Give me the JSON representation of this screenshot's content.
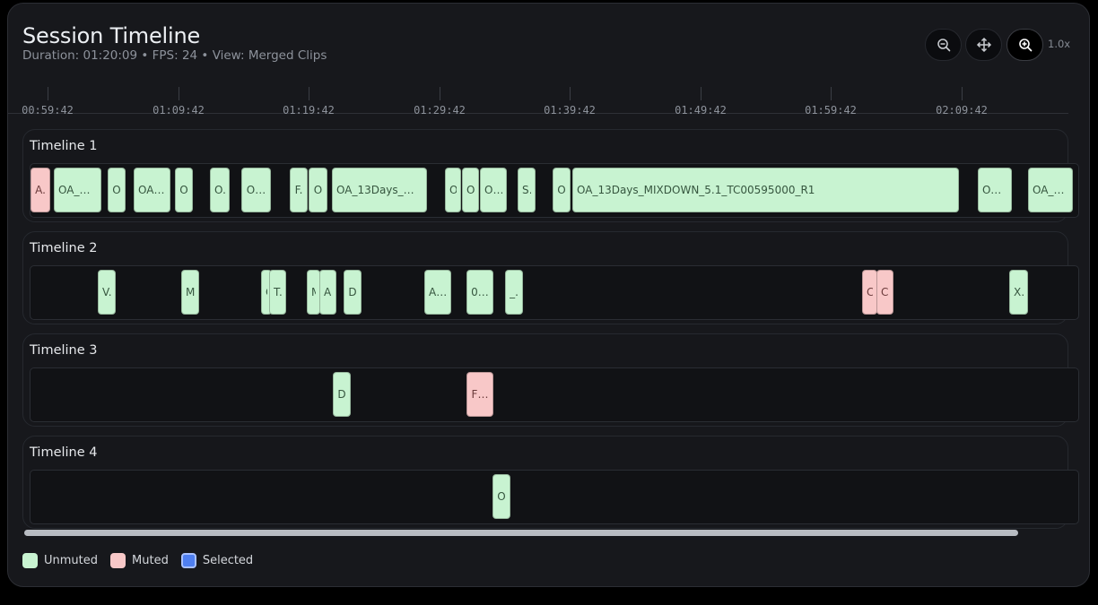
{
  "header": {
    "title": "Session Timeline",
    "subtitle": "Duration: 01:20:09 • FPS: 24 • View: Merged Clips"
  },
  "toolbar": {
    "zoom_out_icon": "zoom-out-icon",
    "pan_icon": "move-icon",
    "zoom_in_icon": "zoom-in-icon",
    "zoom_level": "1.0x"
  },
  "ruler": {
    "ticks": [
      "00:59:42",
      "01:09:42",
      "01:19:42",
      "01:29:42",
      "01:39:42",
      "01:49:42",
      "01:59:42",
      "02:09:42"
    ]
  },
  "tracks": [
    {
      "name": "Timeline 1",
      "clips": [
        {
          "label": "A.",
          "muted": true
        },
        {
          "label": "OA_1…",
          "muted": false
        },
        {
          "label": "O",
          "muted": false
        },
        {
          "label": "OA…",
          "muted": false
        },
        {
          "label": "O",
          "muted": false
        },
        {
          "label": "O.",
          "muted": false
        },
        {
          "label": "O…",
          "muted": false
        },
        {
          "label": "F.",
          "muted": false
        },
        {
          "label": "O",
          "muted": false
        },
        {
          "label": "OA_13Days_MI…",
          "muted": false
        },
        {
          "label": "O",
          "muted": false
        },
        {
          "label": "O",
          "muted": false
        },
        {
          "label": "O…",
          "muted": false
        },
        {
          "label": "S.",
          "muted": false
        },
        {
          "label": "O",
          "muted": false
        },
        {
          "label": "OA_13Days_MIXDOWN_5.1_TC00595000_R1",
          "muted": false
        },
        {
          "label": "OA…",
          "muted": false
        },
        {
          "label": "OA_1…",
          "muted": false
        }
      ]
    },
    {
      "name": "Timeline 2",
      "clips": [
        {
          "label": "V.",
          "muted": false
        },
        {
          "label": "M",
          "muted": false
        },
        {
          "label": "C",
          "muted": false
        },
        {
          "label": "T.",
          "muted": false
        },
        {
          "label": "M",
          "muted": false
        },
        {
          "label": "A.",
          "muted": false
        },
        {
          "label": "D",
          "muted": false
        },
        {
          "label": "A…",
          "muted": false
        },
        {
          "label": "0…",
          "muted": false
        },
        {
          "label": "_.",
          "muted": false
        },
        {
          "label": "C.",
          "muted": true
        },
        {
          "label": "C.",
          "muted": true
        },
        {
          "label": "X.",
          "muted": false
        }
      ]
    },
    {
      "name": "Timeline 3",
      "clips": [
        {
          "label": "D",
          "muted": false
        },
        {
          "label": "F…",
          "muted": true
        }
      ]
    },
    {
      "name": "Timeline 4",
      "clips": [
        {
          "label": "O",
          "muted": false
        }
      ]
    }
  ],
  "legend": {
    "unmuted": "Unmuted",
    "muted": "Muted",
    "selected": "Selected"
  },
  "colors": {
    "unmuted": "#c8f3d1",
    "muted": "#f8c8c8",
    "selected": "#4f7ff0",
    "background": "#17181c"
  }
}
